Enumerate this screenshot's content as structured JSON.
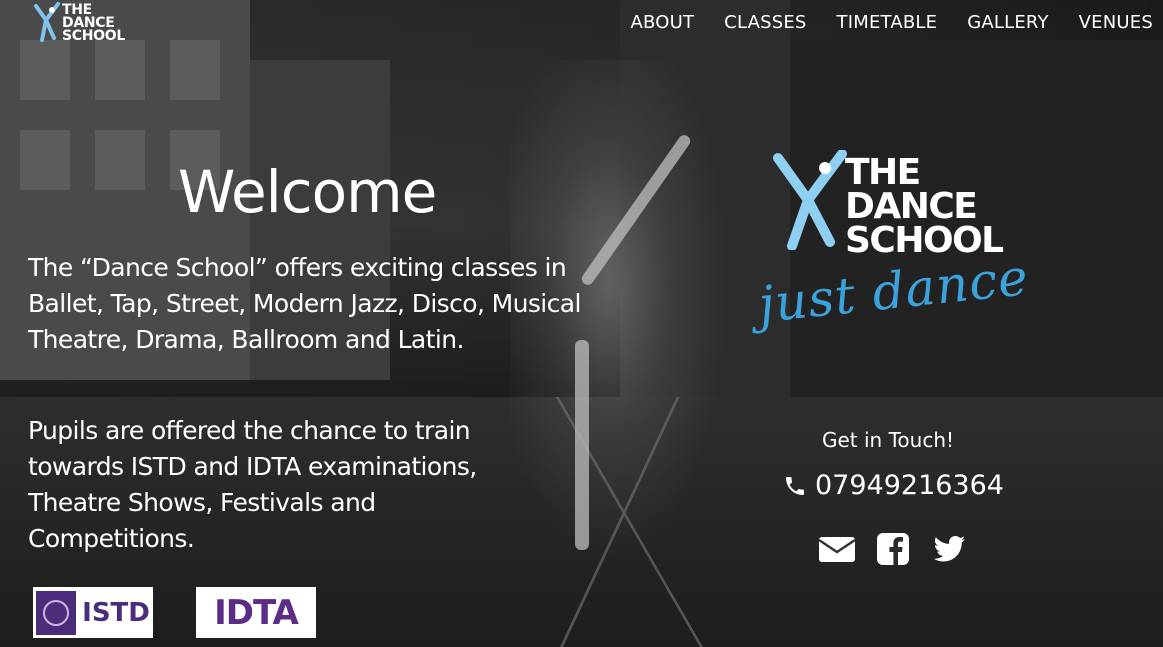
{
  "header": {
    "logo_text": [
      "THE",
      "DANCE",
      "SCHOOL"
    ],
    "nav": [
      "ABOUT",
      "CLASSES",
      "TIMETABLE",
      "GALLERY",
      "VENUES"
    ]
  },
  "main": {
    "title": "Welcome",
    "paragraph1": "The “Dance School” offers exciting classes in Ballet, Tap, Street, Modern Jazz, Disco, Musical Theatre, Drama, Ballroom and Latin.",
    "paragraph2": "Pupils are offered the chance to train towards ISTD and IDTA examinations, Theatre Shows, Festivals and Competitions.",
    "badges": {
      "istd": "ISTD",
      "idta": "IDTA"
    }
  },
  "brand": {
    "logo_text": [
      "THE",
      "DANCE",
      "SCHOOL"
    ],
    "tagline": "just dance",
    "accent_color": "#3ba3db"
  },
  "contact": {
    "heading": "Get in Touch!",
    "phone": "07949216364",
    "icons": [
      "phone-icon",
      "envelope-icon",
      "facebook-icon",
      "twitter-icon"
    ]
  }
}
